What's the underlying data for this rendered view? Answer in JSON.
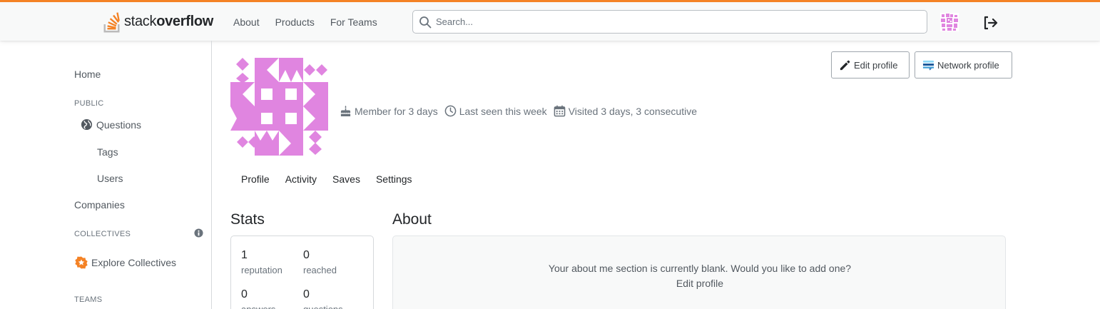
{
  "colors": {
    "accent": "#f48225",
    "avatar": "#e085e0",
    "link_icon": "#0a95ff",
    "collectives": "#f48225"
  },
  "header": {
    "logo_text_a": "stack",
    "logo_text_b": "overflow",
    "nav": [
      "About",
      "Products",
      "For Teams"
    ],
    "search": {
      "placeholder": "Search...",
      "value": ""
    }
  },
  "sidebar": {
    "home": "Home",
    "public_heading": "PUBLIC",
    "questions": "Questions",
    "tags": "Tags",
    "users": "Users",
    "companies": "Companies",
    "collectives_heading": "COLLECTIVES",
    "explore_collectives": "Explore Collectives",
    "teams_heading": "TEAMS"
  },
  "profile": {
    "member_for": "Member for 3 days",
    "last_seen": "Last seen this week",
    "visited": "Visited 3 days, 3 consecutive",
    "edit_profile_button": "Edit profile",
    "network_profile_button": "Network profile",
    "tabs": [
      "Profile",
      "Activity",
      "Saves",
      "Settings"
    ]
  },
  "stats": {
    "heading": "Stats",
    "items": [
      {
        "value": "1",
        "label": "reputation"
      },
      {
        "value": "0",
        "label": "reached"
      },
      {
        "value": "0",
        "label": "answers"
      },
      {
        "value": "0",
        "label": "questions"
      }
    ]
  },
  "about": {
    "heading": "About",
    "blank_text": "Your about me section is currently blank. Would you like to add one?",
    "edit_link": "Edit profile"
  }
}
